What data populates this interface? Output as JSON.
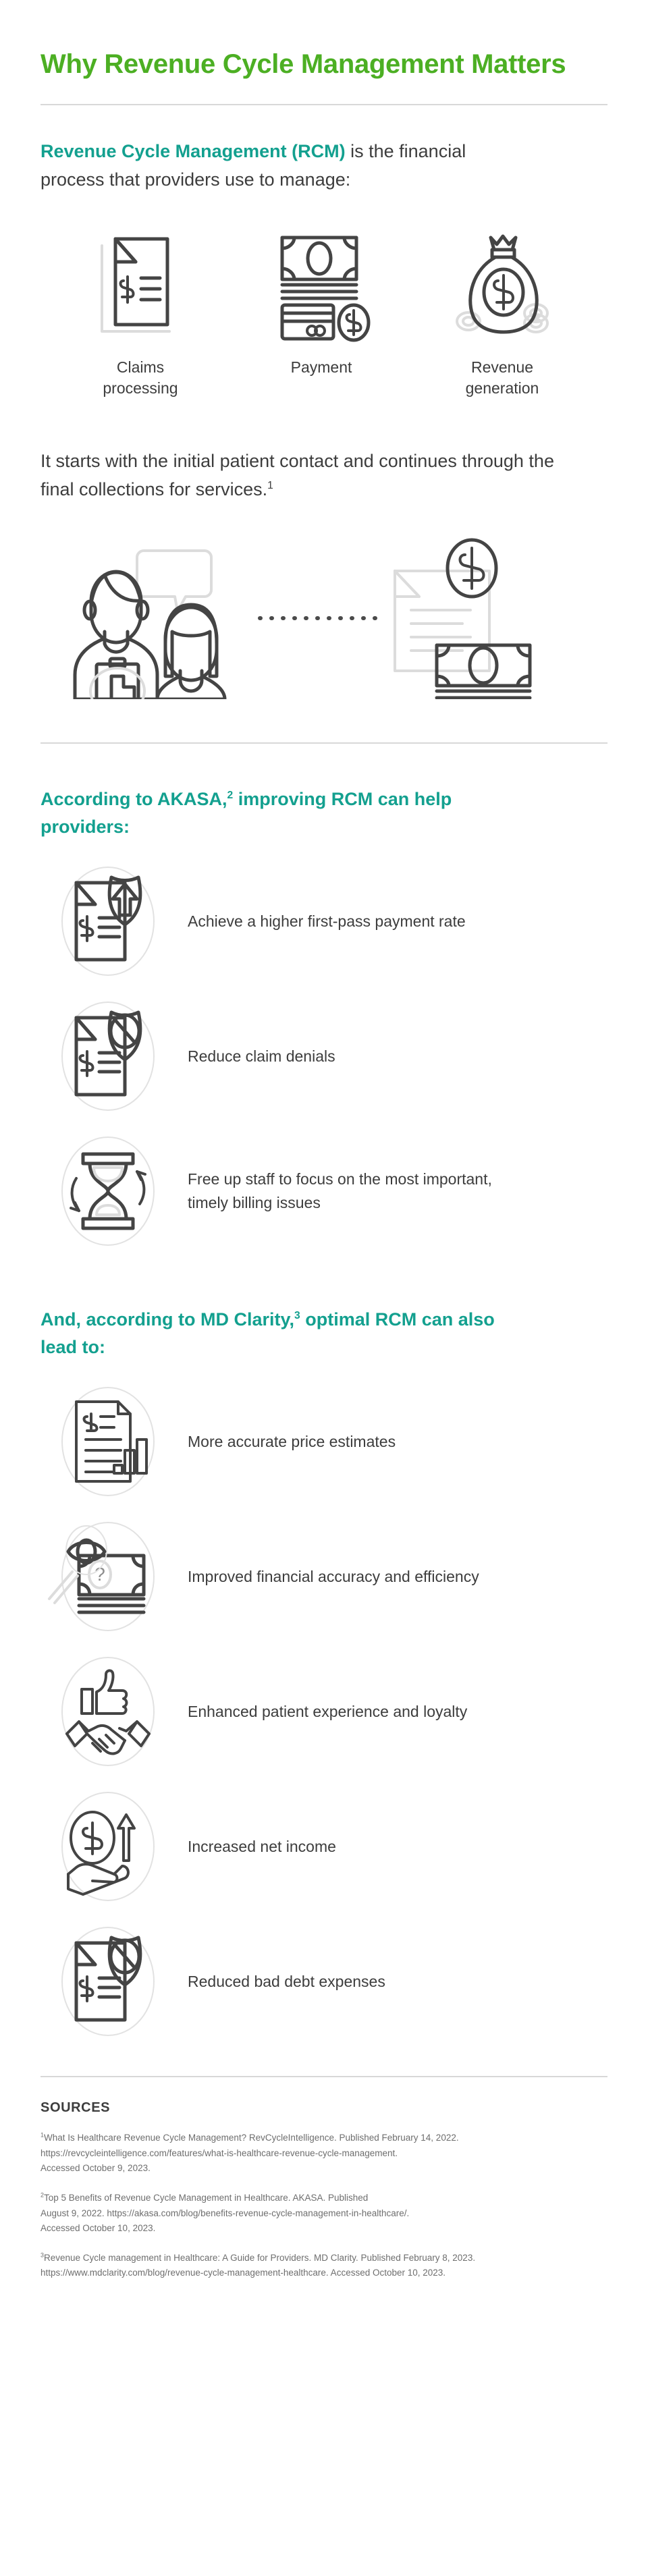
{
  "title": "Why Revenue Cycle Management Matters",
  "colors": {
    "title_green": "#4caf23",
    "accent_teal": "#13a08f",
    "body_text": "#3d3d3d",
    "source_text": "#6e6e6e",
    "rule_gray": "#d8d8d8",
    "icon_dark": "#444444",
    "icon_light": "#dcdcdc"
  },
  "intro": {
    "highlight": "Revenue Cycle Management (RCM)",
    "rest": " is the financial process that providers use to manage:"
  },
  "trio": [
    {
      "label": "Claims\nprocessing",
      "icon": "document-dollar-icon"
    },
    {
      "label": "Payment",
      "icon": "cash-and-card-icon"
    },
    {
      "label": "Revenue\ngeneration",
      "icon": "money-bag-icon"
    }
  ],
  "narrative": {
    "text": "It starts with the initial patient contact and continues through the final collections for services.",
    "footnote": "1"
  },
  "scene": {
    "icon": "patient-provider-to-invoice-scene"
  },
  "akasa": {
    "heading_before": "According to AKASA,",
    "heading_footnote": "2",
    "heading_after": " improving RCM can help providers:",
    "items": [
      {
        "text": "Achieve a higher first-pass payment rate",
        "icon": "document-shield-uparrow-icon"
      },
      {
        "text": "Reduce claim denials",
        "icon": "document-shield-prohibited-icon"
      },
      {
        "text": "Free up staff to focus on the most important, timely billing issues",
        "icon": "hourglass-rotate-icon"
      }
    ]
  },
  "mdclarity": {
    "heading_before": "And, according to MD Clarity,",
    "heading_footnote": "3",
    "heading_after": " optimal RCM can also lead to:",
    "items": [
      {
        "text": "More accurate price estimates",
        "icon": "document-barchart-icon"
      },
      {
        "text": "Improved financial accuracy and efficiency",
        "icon": "magnifier-eye-cash-question-icon"
      },
      {
        "text": "Enhanced patient experience and loyalty",
        "icon": "thumbsup-handshake-icon"
      },
      {
        "text": "Increased net income",
        "icon": "hand-coin-uparrow-icon"
      },
      {
        "text": "Reduced bad debt expenses",
        "icon": "document-shield-prohibited-icon"
      }
    ]
  },
  "sources": {
    "title": "SOURCES",
    "entries": [
      {
        "num": "1",
        "line1": "What Is Healthcare Revenue Cycle Management? RevCycleIntelligence. Published February 14, 2022.",
        "line2": "https://revcycleintelligence.com/features/what-is-healthcare-revenue-cycle-management.",
        "line3": "Accessed October 9, 2023."
      },
      {
        "num": "2",
        "line1": "Top 5 Benefits of Revenue Cycle Management in Healthcare. AKASA. Published",
        "line2": "August 9, 2022. https://akasa.com/blog/benefits-revenue-cycle-management-in-healthcare/.",
        "line3": "Accessed October 10, 2023."
      },
      {
        "num": "3",
        "line1": "Revenue Cycle management in Healthcare: A Guide for Providers. MD Clarity. Published February 8, 2023.",
        "line2": "https://www.mdclarity.com/blog/revenue-cycle-management-healthcare. Accessed October 10, 2023.",
        "line3": ""
      }
    ]
  }
}
